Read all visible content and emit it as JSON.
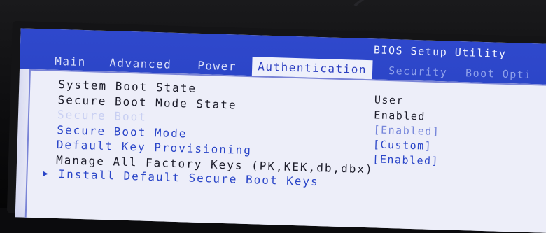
{
  "header": {
    "utility_title": "BIOS Setup Utility",
    "tabs": [
      {
        "label": "Main"
      },
      {
        "label": "Advanced"
      },
      {
        "label": "Power"
      },
      {
        "label": "Authentication",
        "active": true
      },
      {
        "label": "Security"
      },
      {
        "label": "Boot Opti"
      }
    ]
  },
  "items": [
    {
      "label": "System Boot State",
      "value": "User"
    },
    {
      "label": "Secure Boot Mode State",
      "value": "Enabled"
    },
    {
      "label": "Secure Boot",
      "value": "[Enabled]"
    },
    {
      "label": "Secure Boot Mode",
      "value": "[Custom]"
    },
    {
      "label": "Default Key Provisioning",
      "value": "[Enabled]"
    },
    {
      "label": "Manage All Factory Keys (PK,KEK,db,dbx)"
    },
    {
      "label": "Install Default Secure Boot Keys"
    }
  ],
  "colors": {
    "header_blue": "#2f48cc",
    "panel_bg": "#ecedf8",
    "link_blue": "#2a45c8",
    "selected_text": "#c8cff2"
  }
}
